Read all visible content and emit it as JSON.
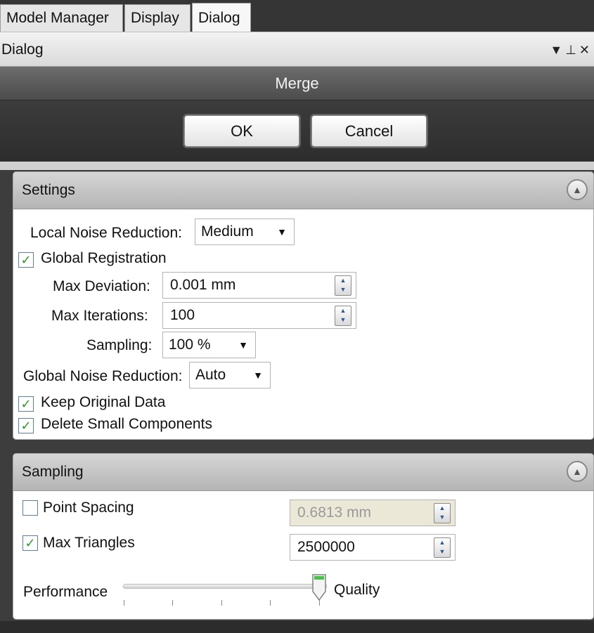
{
  "tabs": [
    {
      "label": "Model Manager"
    },
    {
      "label": "Display"
    },
    {
      "label": "Dialog"
    }
  ],
  "dock": {
    "title": "Dialog",
    "icons": [
      "dropdown-arrow-icon",
      "pin-icon",
      "close-icon"
    ]
  },
  "dialog": {
    "title": "Merge",
    "ok_label": "OK",
    "cancel_label": "Cancel"
  },
  "settings": {
    "header": "Settings",
    "local_noise_label": "Local Noise Reduction:",
    "local_noise_value": "Medium",
    "global_registration_label": "Global Registration",
    "global_registration_checked": true,
    "max_deviation_label": "Max Deviation:",
    "max_deviation_value": "0.001 mm",
    "max_iterations_label": "Max Iterations:",
    "max_iterations_value": "100",
    "sampling_label": "Sampling:",
    "sampling_value": "100 %",
    "global_noise_label": "Global Noise Reduction:",
    "global_noise_value": "Auto",
    "keep_original_label": "Keep Original Data",
    "keep_original_checked": true,
    "delete_small_label": "Delete Small Components",
    "delete_small_checked": true
  },
  "sampling": {
    "header": "Sampling",
    "point_spacing_label": "Point Spacing",
    "point_spacing_checked": false,
    "point_spacing_value": "0.6813 mm",
    "max_triangles_label": "Max Triangles",
    "max_triangles_checked": true,
    "max_triangles_value": "2500000",
    "slider_left_label": "Performance",
    "slider_right_label": "Quality",
    "slider_position": 1.0
  }
}
